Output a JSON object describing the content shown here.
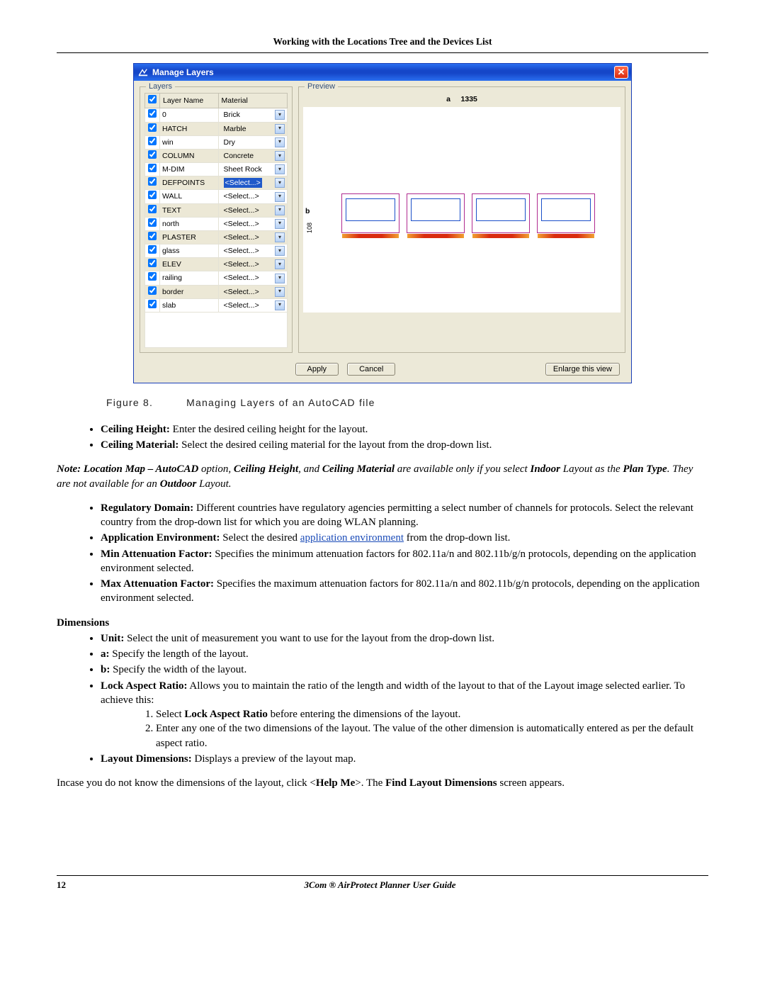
{
  "header": {
    "title": "Working with the Locations Tree and the Devices List"
  },
  "dialog": {
    "title": "Manage Layers",
    "layers_legend": "Layers",
    "preview_legend": "Preview",
    "col_name": "Layer Name",
    "col_material": "Material",
    "rows": [
      {
        "name": "0",
        "material": "Brick",
        "selhl": false
      },
      {
        "name": "HATCH",
        "material": "Marble",
        "selhl": false
      },
      {
        "name": "win",
        "material": "Dry",
        "selhl": false
      },
      {
        "name": "COLUMN",
        "material": "Concrete",
        "selhl": false
      },
      {
        "name": "M-DIM",
        "material": "Sheet Rock",
        "selhl": false
      },
      {
        "name": "DEFPOINTS",
        "material": "<Select...>",
        "selhl": true
      },
      {
        "name": "WALL",
        "material": "<Select...>",
        "selhl": false
      },
      {
        "name": "TEXT",
        "material": "<Select...>",
        "selhl": false
      },
      {
        "name": "north",
        "material": "<Select...>",
        "selhl": false
      },
      {
        "name": "PLASTER",
        "material": "<Select...>",
        "selhl": false
      },
      {
        "name": "glass",
        "material": "<Select...>",
        "selhl": false
      },
      {
        "name": "ELEV",
        "material": "<Select...>",
        "selhl": false
      },
      {
        "name": "railing",
        "material": "<Select...>",
        "selhl": false
      },
      {
        "name": "border",
        "material": "<Select...>",
        "selhl": false
      },
      {
        "name": "slab",
        "material": "<Select...>",
        "selhl": false
      }
    ],
    "preview_top_a": "a",
    "preview_top_val": "1335",
    "preview_side_b": "b",
    "preview_side_val": "108",
    "apply": "Apply",
    "cancel": "Cancel",
    "enlarge": "Enlarge this view"
  },
  "caption": {
    "num": "Figure 8.",
    "text": "Managing Layers of an AutoCAD file"
  },
  "b1": {
    "ceil_h_b": "Ceiling Height:",
    "ceil_h_t": " Enter the desired ceiling height for the layout.",
    "ceil_m_b": "Ceiling Material:",
    "ceil_m_t": " Select the desired ceiling material for the layout from the drop-down list."
  },
  "note": {
    "lead": "Note: Location Map – AutoCAD",
    "mid1": " option, ",
    "b1": "Ceiling Height",
    "mid2": ", and ",
    "b2": "Ceiling Material",
    "mid3": " are available only if you select ",
    "b3": "Indoor",
    "mid4": " Layout as the ",
    "b4": "Plan Type",
    "mid5": ". They are not available for an ",
    "b5": "Outdoor",
    "mid6": " Layout."
  },
  "b2": {
    "reg_b": "Regulatory Domain:",
    "reg_t": " Different countries have regulatory agencies permitting a select number of channels for protocols. Select the relevant country from the drop-down list for which you are doing WLAN planning.",
    "app_b": "Application Environment:",
    "app_t1": " Select the desired ",
    "app_link": "application environment",
    "app_t2": " from the drop-down list.",
    "min_b": "Min Attenuation Factor:",
    "min_t": " Specifies the minimum attenuation factors for 802.11a/n and 802.11b/g/n protocols, depending on the application environment selected.",
    "max_b": "Max Attenuation Factor:",
    "max_t": " Specifies the maximum attenuation factors for 802.11a/n and 802.11b/g/n protocols, depending on the application environment selected."
  },
  "dims": {
    "head": "Dimensions",
    "unit_b": "Unit:",
    "unit_t": " Select the unit of measurement you want to use for the layout from the drop-down list.",
    "a_b": "a:",
    "a_t": " Specify the length of the layout.",
    "bb_b": "b:",
    "bb_t": " Specify the width of the layout.",
    "lar_b": "Lock Aspect Ratio:",
    "lar_t": " Allows you to maintain the ratio of the length and width of the layout to that of the Layout image selected earlier. To achieve this:",
    "ol1a": "Select ",
    "ol1b": "Lock Aspect Ratio",
    "ol1c": " before entering the dimensions of the layout.",
    "ol2": "Enter any one of the two dimensions of the layout. The value of the other dimension is automatically entered as per the default aspect ratio.",
    "ld_b": "Layout Dimensions:",
    "ld_t": " Displays a preview of the layout map."
  },
  "tail": {
    "p1": "Incase you do not know the dimensions of the layout, click <",
    "hb": "Help Me",
    "p2": ">. The ",
    "fb": "Find Layout Dimensions",
    "p3": " screen appears."
  },
  "footer": {
    "page": "12",
    "book": "3Com ® AirProtect Planner User Guide"
  }
}
